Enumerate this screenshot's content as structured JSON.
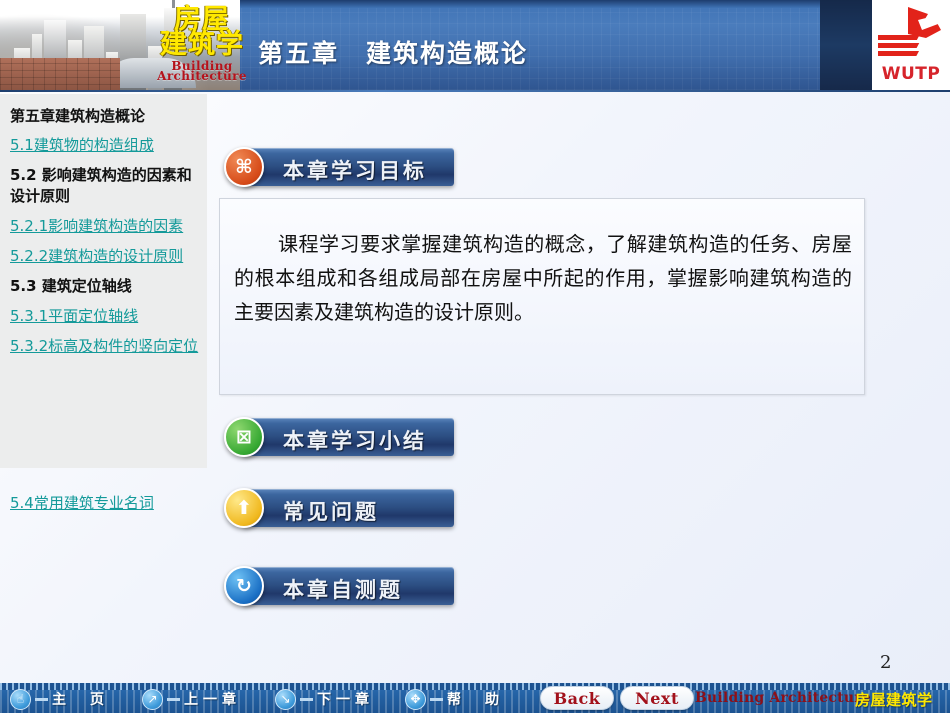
{
  "header": {
    "logo_cn_line1": "房屋",
    "logo_cn_line2": "建筑学",
    "logo_en_line1": "Building",
    "logo_en_line2": "Architecture",
    "title": "第五章　建筑构造概论",
    "publisher_abbr": "WUTP",
    "publisher_mark_icon": "wutp-logo-icon"
  },
  "sidebar": {
    "heading": "第五章建筑构造概论",
    "items": [
      {
        "label": "5.1建筑物的构造组成",
        "type": "link"
      },
      {
        "label": "5.2 影响建筑构造的因素和设计原则",
        "type": "heading"
      },
      {
        "label": "5.2.1影响建筑构造的因素",
        "type": "link"
      },
      {
        "label": "5.2.2建筑构造的设计原则",
        "type": "link"
      },
      {
        "label": "5.3 建筑定位轴线",
        "type": "heading"
      },
      {
        "label": "5.3.1平面定位轴线",
        "type": "link"
      },
      {
        "label": "5.3.2标高及构件的竖向定位",
        "type": "link"
      },
      {
        "label": "5.4常用建筑专业名词",
        "type": "link"
      }
    ]
  },
  "main": {
    "buttons": [
      {
        "label": "本章学习目标",
        "icon": "command-icon",
        "icon_glyph": "⌘",
        "icon_color": "#d64a18"
      },
      {
        "label": "本章学习小结",
        "icon": "chart-box-icon",
        "icon_glyph": "⊠",
        "icon_color": "#36a832"
      },
      {
        "label": "常见问题",
        "icon": "arrow-up-icon",
        "icon_glyph": "⬆",
        "icon_color": "#f0b81e"
      },
      {
        "label": "本章自测题",
        "icon": "refresh-icon",
        "icon_glyph": "↻",
        "icon_color": "#1a6fc4"
      }
    ],
    "body_text": "课程学习要求掌握建筑构造的概念，了解建筑构造的任务、房屋的根本组成和各组成局部在房屋中所起的作用，掌握影响建筑构造的主要因素及建筑构造的设计原则。",
    "page_number": "2"
  },
  "footer": {
    "nav": [
      {
        "label": "主　页",
        "icon": "home-icon",
        "icon_glyph": "☝"
      },
      {
        "label": "上一章",
        "icon": "prev-icon",
        "icon_glyph": "↗"
      },
      {
        "label": "下一章",
        "icon": "next-icon",
        "icon_glyph": "↘"
      },
      {
        "label": "帮　助",
        "icon": "help-move-icon",
        "icon_glyph": "✥"
      }
    ],
    "back_label": "Back",
    "next_label": "Next",
    "brand_en": "Building Architecture",
    "brand_cn": "房屋建筑学"
  },
  "colors": {
    "header_blue": "#3f73b5",
    "link_teal": "#149a9a",
    "brand_red": "#b5121b",
    "brand_yellow": "#ffe800",
    "footer_blue": "#2463a6"
  }
}
